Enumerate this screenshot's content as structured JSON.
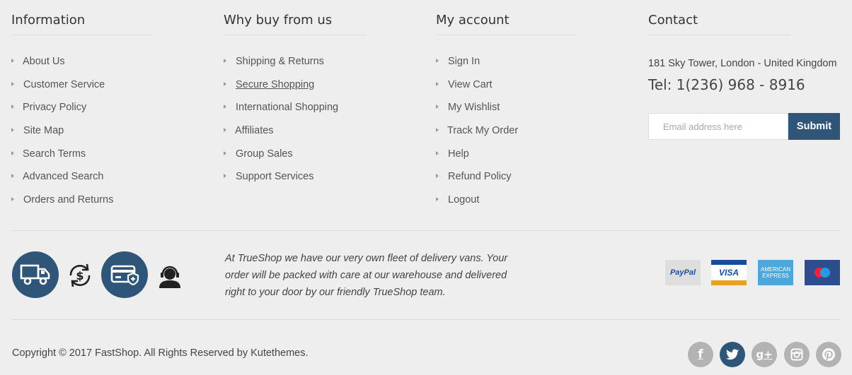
{
  "information": {
    "title": "Information",
    "links": [
      "About Us",
      "Customer Service",
      "Privacy Policy",
      "Site Map",
      "Search Terms",
      "Advanced Search",
      "Orders and Returns"
    ]
  },
  "why_buy": {
    "title": "Why buy from us",
    "links": [
      "Shipping & Returns",
      "Secure Shopping",
      "International Shopping",
      "Affiliates",
      "Group Sales",
      "Support Services"
    ]
  },
  "my_account": {
    "title": "My account",
    "links": [
      "Sign In",
      "View Cart",
      "My Wishlist",
      "Track My Order",
      "Help",
      "Refund Policy",
      "Logout"
    ]
  },
  "contact": {
    "title": "Contact",
    "address": "181 Sky Tower, London - United Kingdom",
    "phone": "Tel: 1(236) 968 - 8916",
    "email_placeholder": "Email address here",
    "submit_label": "Submit"
  },
  "features": {
    "icons": [
      "delivery-truck-icon",
      "money-back-icon",
      "secure-payment-card-icon",
      "customer-support-icon"
    ]
  },
  "promo_text": "At TrueShop we have our very own fleet of delivery vans. Your order will be packed with care at our warehouse and delivered right to your door by our friendly TrueShop team.",
  "payments": {
    "paypal": "PayPal",
    "visa": "VISA",
    "amex_line1": "AMERICAN",
    "amex_line2": "EXPRESS"
  },
  "copyright": "Copyright © 2017 FastShop. All Rights Reserved by Kutethemes.",
  "social": {
    "facebook": "f",
    "google_plus": "g+"
  },
  "colors": {
    "accent": "#2f5679",
    "background": "#eeeeee",
    "social_inactive": "#b3b3b3"
  }
}
